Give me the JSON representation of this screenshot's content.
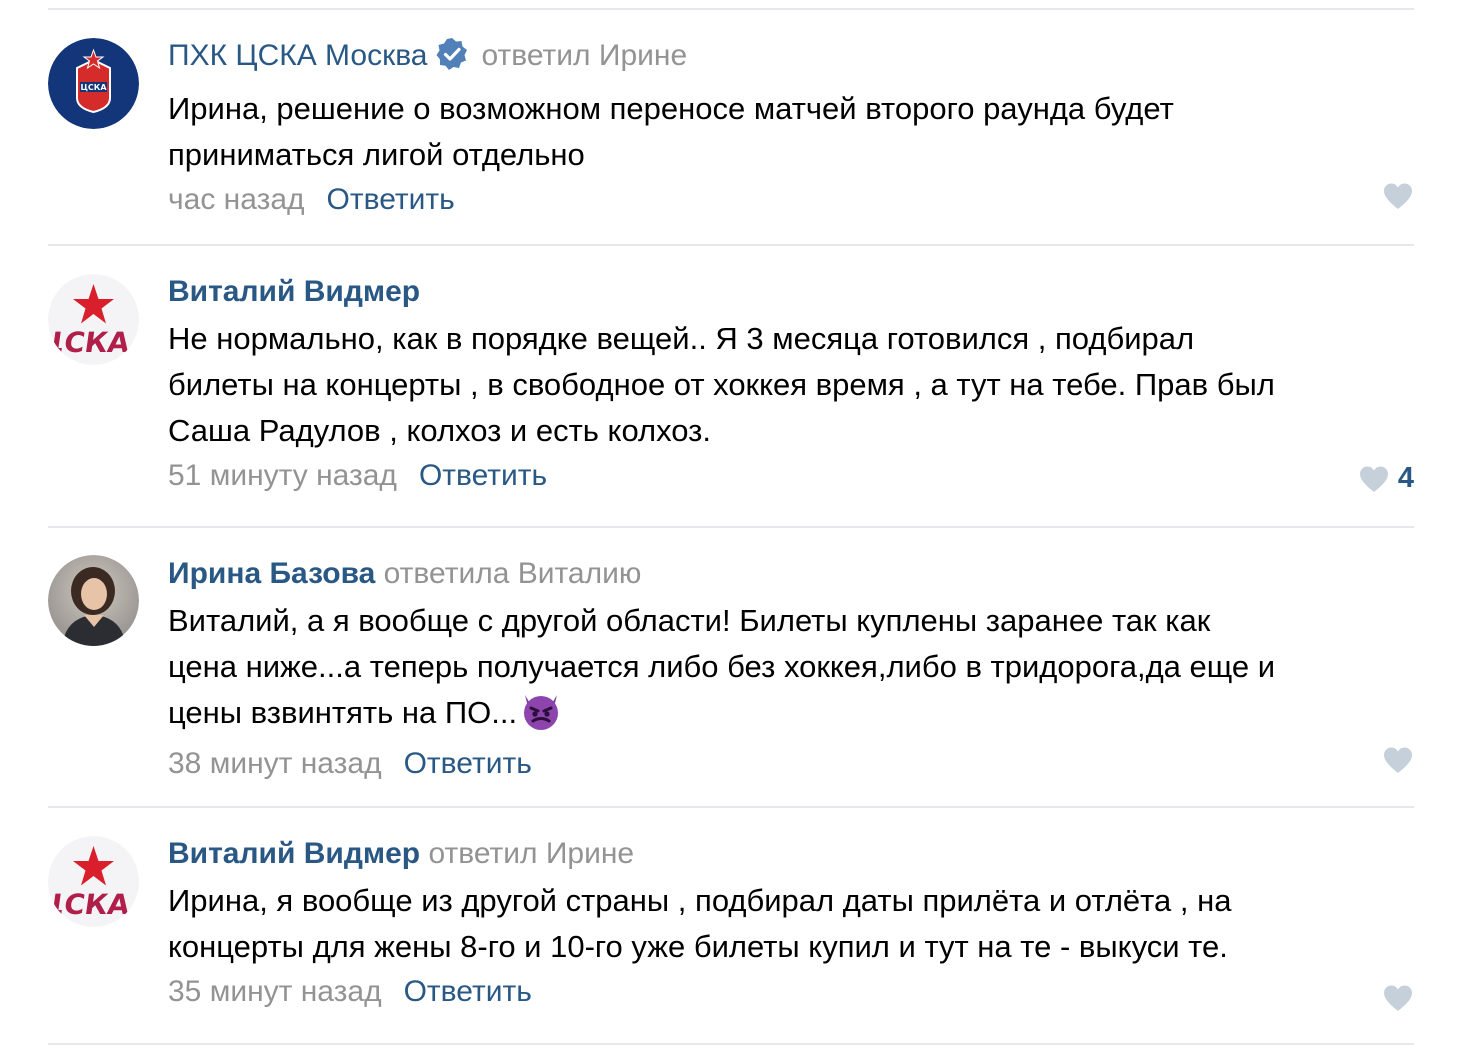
{
  "comments": [
    {
      "author": "ПХК ЦСКА Москва",
      "verified": true,
      "reply_to": "ответил Ирине",
      "text": "Ирина, решение о возможном переносе матчей второго раунда будет\nприниматься лигой отдельно",
      "time": "час назад",
      "reply_label": "Ответить",
      "likes": "",
      "avatar": "cska-club-logo"
    },
    {
      "author": "Виталий Видмер",
      "verified": false,
      "reply_to": "",
      "text": "Не нормально, как в порядке вещей.. Я 3 месяца готовился , подбирал\nбилеты на концерты , в свободное от хоккея время , а тут на тебе. Прав был\nСаша Радулов , колхоз и есть колхоз.",
      "time": "51 минуту назад",
      "reply_label": "Ответить",
      "likes": "4",
      "avatar": "cska-star-logo"
    },
    {
      "author": "Ирина Базова",
      "verified": false,
      "reply_to": "ответила Виталию",
      "text": "Виталий, а я вообще с другой области! Билеты куплены заранее так как\nцена ниже...а теперь получается либо без хоккея,либо в тридорога,да еще и\nцены взвинтять на ПО...",
      "time": "38 минут назад",
      "reply_label": "Ответить",
      "likes": "",
      "avatar": "user-photo"
    },
    {
      "author": "Виталий Видмер",
      "verified": false,
      "reply_to": "ответил Ирине",
      "text": "Ирина, я вообще из другой страны , подбирал даты прилёта и отлёта , на\nконцерты для жены 8-го и 10-го уже билеты купил и тут на те - выкуси те.",
      "time": "35 минут назад",
      "reply_label": "Ответить",
      "likes": "",
      "avatar": "cska-star-logo"
    }
  ],
  "colors": {
    "link": "#2a5885",
    "muted": "#939393",
    "divider": "#e7e8ec",
    "heart": "#c5d0db",
    "verified": "#5181b8"
  }
}
